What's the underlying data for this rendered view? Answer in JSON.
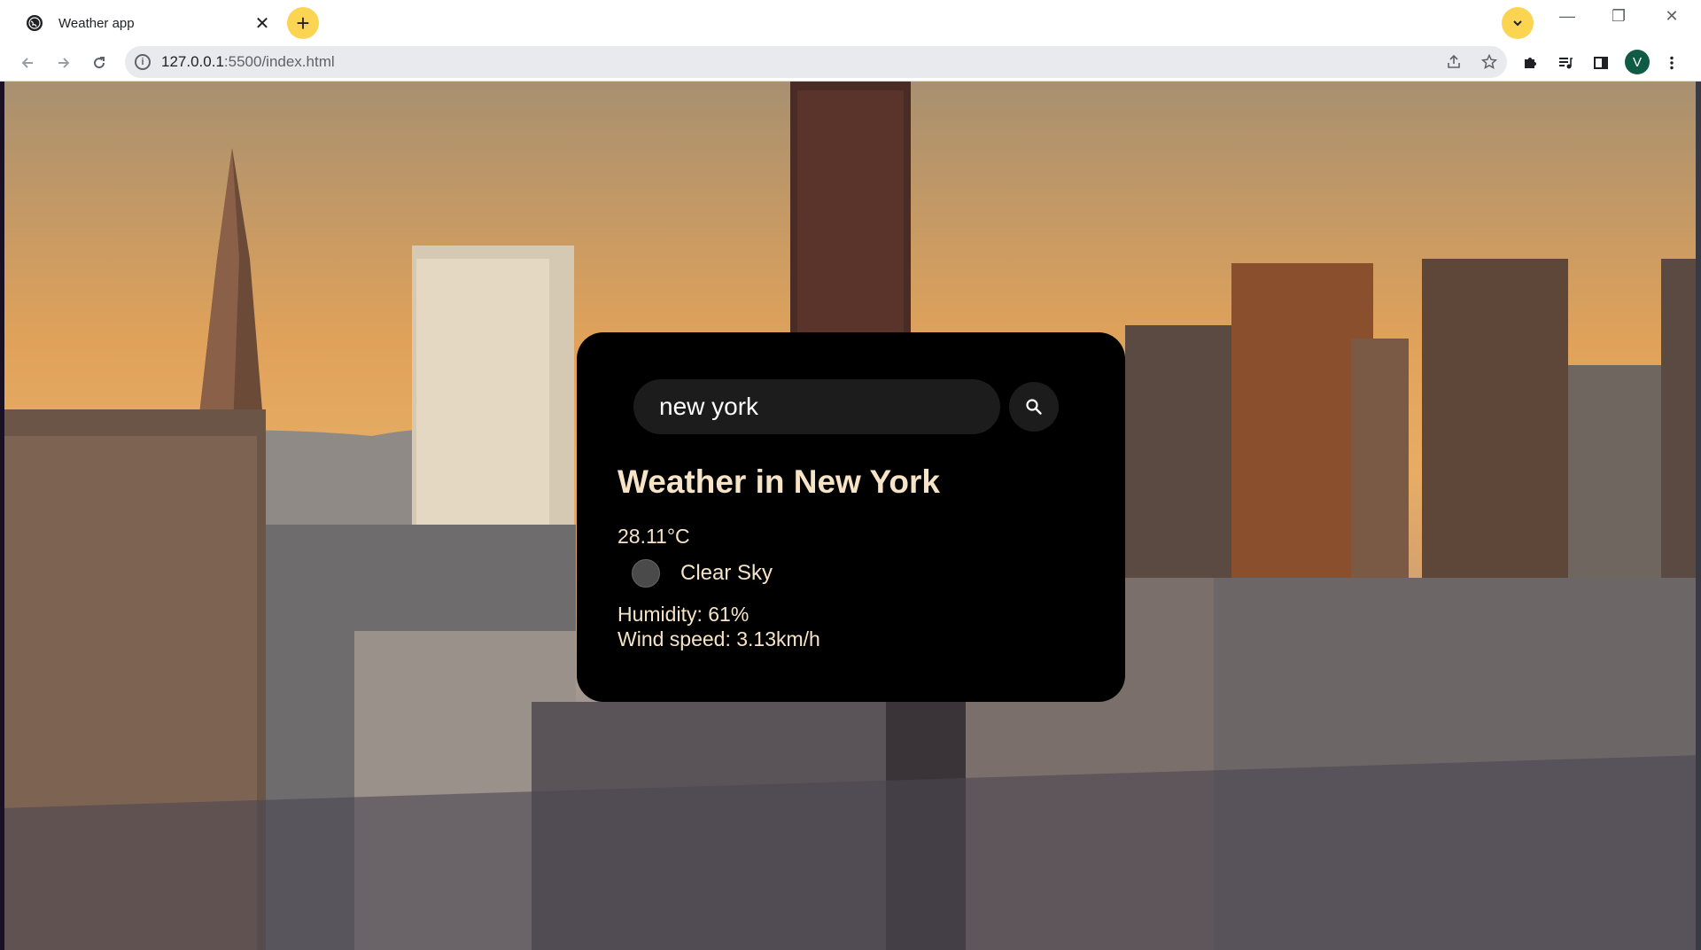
{
  "browser": {
    "tab": {
      "title": "Weather app",
      "close_glyph": "✕"
    },
    "new_tab_glyph": "+",
    "address": {
      "host": "127.0.0.1",
      "path": ":5500/index.html"
    },
    "profile_initial": "V",
    "window_controls": {
      "minimize": "—",
      "restore": "❐",
      "close": "✕"
    },
    "colors": {
      "tab_button_accent": "#fbd451",
      "avatar": "#0f5b44"
    }
  },
  "weather_card": {
    "search": {
      "value": "new york",
      "placeholder": ""
    },
    "title": "Weather in New York",
    "temperature": "28.11°C",
    "description": "Clear Sky",
    "humidity": "Humidity: 61%",
    "wind": "Wind speed: 3.13km/h",
    "colors": {
      "background": "#000000",
      "text": "#f7e4c6"
    }
  }
}
